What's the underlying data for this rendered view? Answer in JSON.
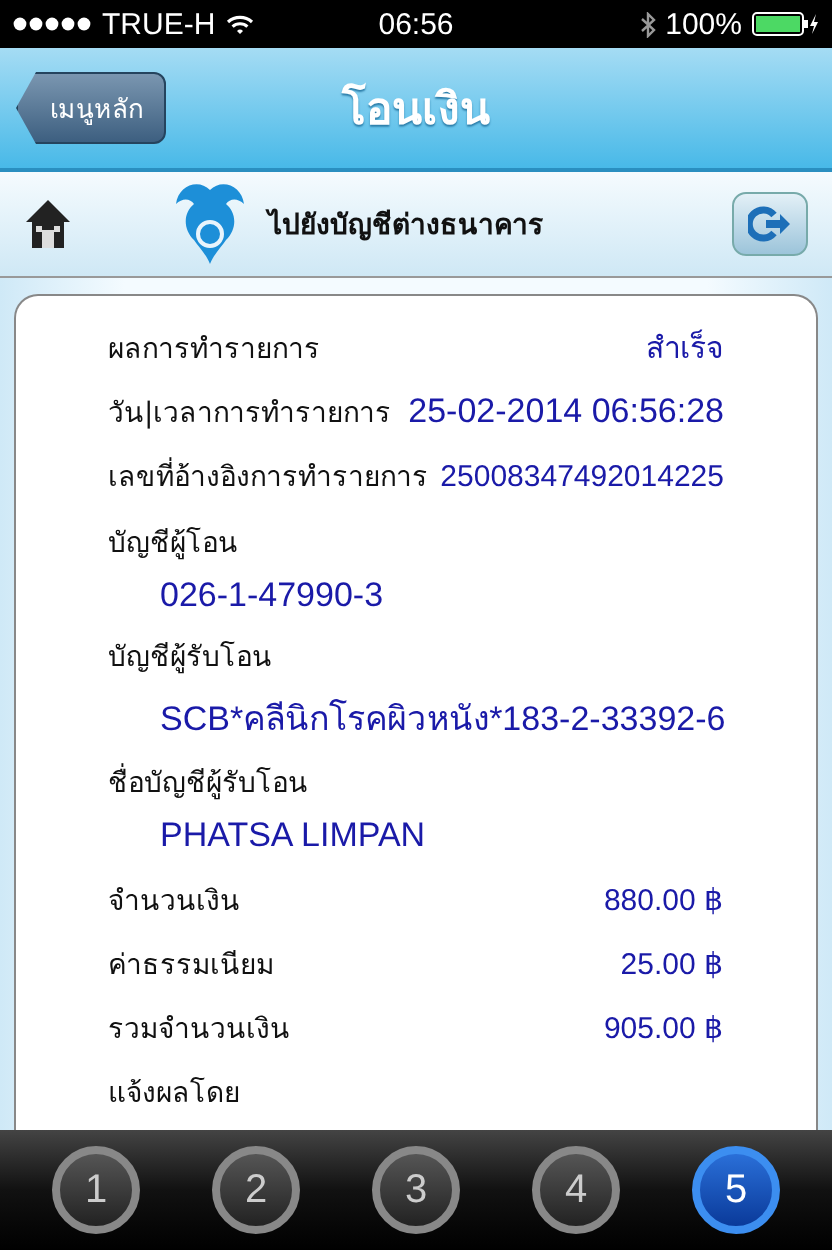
{
  "status_bar": {
    "carrier": "TRUE-H",
    "time": "06:56",
    "battery": "100%"
  },
  "nav": {
    "back": "เมนูหลัก",
    "title": "โอนเงิน"
  },
  "subheader": {
    "title": "ไปยังบัญชีต่างธนาคาร"
  },
  "rows": [
    {
      "kind": "inline",
      "label": "ผลการทำรายการ",
      "value": "สำเร็จ"
    },
    {
      "kind": "inline",
      "label": "วัน|เวลาการทำรายการ",
      "value": "25-02-2014 06:56:28"
    },
    {
      "kind": "inline",
      "label": "เลขที่อ้างอิงการทำรายการ",
      "value": "25008347492014225"
    },
    {
      "kind": "stacked",
      "label": "บัญชีผู้โอน",
      "value": "026-1-47990-3"
    },
    {
      "kind": "stacked",
      "label": "บัญชีผู้รับโอน",
      "value": "SCB*คลีนิกโรคผิวหนัง*183-2-33392-6"
    },
    {
      "kind": "stacked",
      "label": "ชื่อบัญชีผู้รับโอน",
      "value": "PHATSA LIMPAN"
    },
    {
      "kind": "inline",
      "label": "จำนวนเงิน",
      "value": "880.00 ฿"
    },
    {
      "kind": "inline",
      "label": "ค่าธรรมเนียม",
      "value": "25.00 ฿"
    },
    {
      "kind": "inline",
      "label": "รวมจำนวนเงิน",
      "value": "905.00 ฿"
    },
    {
      "kind": "label",
      "label": "แจ้งผลโดย"
    }
  ],
  "steps": [
    {
      "label": "1",
      "selected": false
    },
    {
      "label": "2",
      "selected": false
    },
    {
      "label": "3",
      "selected": false
    },
    {
      "label": "4",
      "selected": false
    },
    {
      "label": "5",
      "selected": true
    }
  ]
}
